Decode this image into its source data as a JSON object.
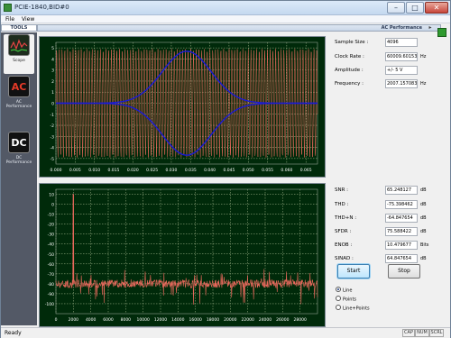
{
  "window": {
    "title": "PCIE-1840,BID#0"
  },
  "menu": {
    "file": "File",
    "view": "View"
  },
  "tools": {
    "header": "TOOLS",
    "items": [
      {
        "label": "Scope"
      },
      {
        "label": "AC\nPerformance"
      },
      {
        "label": "DC\nPerformance"
      }
    ]
  },
  "panel": {
    "header": "AC Performance",
    "sample_size": {
      "label": "Sample Size :",
      "value": "4096"
    },
    "clock_rate": {
      "label": "Clock Rate :",
      "value": "60009.60153",
      "unit": "Hz"
    },
    "amplitude": {
      "label": "Amplitude :",
      "value": "+/- 5 V"
    },
    "frequency": {
      "label": "Frequency :",
      "value": "2007.157083",
      "unit": "Hz"
    },
    "snr": {
      "label": "SNR :",
      "value": "65.248127",
      "unit": "dB"
    },
    "thd": {
      "label": "THD :",
      "value": "-75.398462",
      "unit": "dB"
    },
    "thdn": {
      "label": "THD+N :",
      "value": "-64.847654",
      "unit": "dB"
    },
    "sfdr": {
      "label": "SFDR :",
      "value": "75.588422",
      "unit": "dB"
    },
    "enob": {
      "label": "ENOB :",
      "value": "10.479677",
      "unit": "Bits"
    },
    "sinad": {
      "label": "SINAD :",
      "value": "64.847654",
      "unit": "dB"
    },
    "start": "Start",
    "stop": "Stop",
    "radios": [
      {
        "label": "Line",
        "selected": true
      },
      {
        "label": "Points",
        "selected": false
      },
      {
        "label": "Line+Points",
        "selected": false
      }
    ]
  },
  "status": {
    "text": "Ready",
    "cap": "CAP",
    "num": "NUM",
    "scrl": "SCRL"
  },
  "colors": {
    "plot_bg": "#002a0a",
    "grid": "#d8e6b8",
    "trace": "#e8685c",
    "envelope": "#1a1ad8",
    "axis_text": "#ffffff"
  },
  "chart_data": [
    {
      "type": "line",
      "name": "time-domain",
      "xlim": [
        0,
        0.068
      ],
      "ylim": [
        -5.5,
        5.5
      ],
      "x_ticks": [
        "0.000",
        "0.005",
        "0.010",
        "0.015",
        "0.020",
        "0.025",
        "0.030",
        "0.035",
        "0.040",
        "0.045",
        "0.050",
        "0.055",
        "0.060",
        "0.065"
      ],
      "y_ticks": [
        "5",
        "4",
        "3",
        "2",
        "1",
        "0",
        "-1",
        "-2",
        "-3",
        "-4",
        "-5"
      ],
      "signal_amplitude": 4.9,
      "envelope": {
        "center": 0.034,
        "peak": 4.7,
        "width": 0.009
      },
      "grid": true
    },
    {
      "type": "line",
      "name": "spectrum",
      "xlim": [
        0,
        30000
      ],
      "ylim": [
        -110,
        15
      ],
      "x_ticks": [
        "0",
        "2000",
        "4000",
        "6000",
        "8000",
        "10000",
        "12000",
        "14000",
        "16000",
        "18000",
        "20000",
        "22000",
        "24000",
        "26000",
        "28000"
      ],
      "y_ticks": [
        "10",
        "0",
        "-10",
        "-20",
        "-30",
        "-40",
        "-50",
        "-60",
        "-70",
        "-80",
        "-90",
        "-100"
      ],
      "peak": {
        "x": 2000,
        "y": 10
      },
      "noise_floor": -80,
      "grid": true
    }
  ]
}
